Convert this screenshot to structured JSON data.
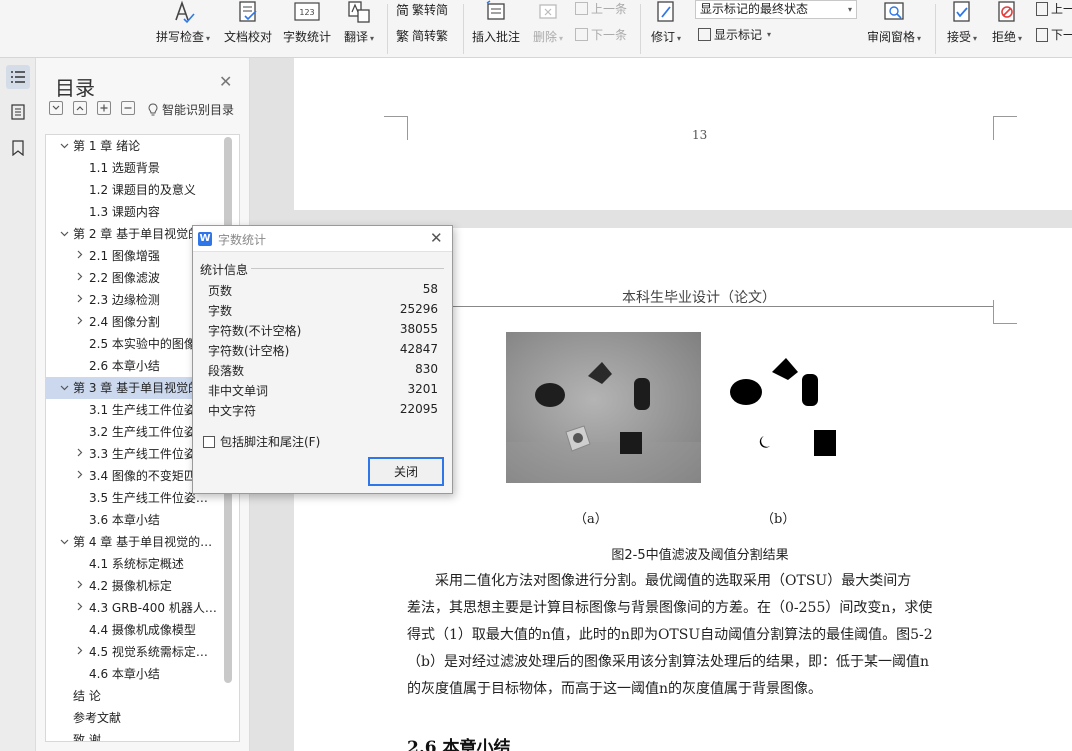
{
  "ribbon": {
    "spell_check": "拼写检查",
    "doc_proof": "文档校对",
    "word_count": "字数统计",
    "translate": "翻译",
    "trad_to_simp": "繁转简",
    "simp_to_trad": "简转繁",
    "insert_comment": "插入批注",
    "delete": "删除",
    "prev_item": "上一条",
    "next_item": "下一条",
    "revise": "修订",
    "markup_state": "显示标记的最终状态",
    "show_markup": "显示标记",
    "review_pane": "审阅窗格",
    "accept": "接受",
    "reject": "拒绝",
    "prev_change": "上一",
    "next_change": "下一",
    "icon_123": "123"
  },
  "toc": {
    "title": "目录",
    "smart_identify": "智能识别目录",
    "items": [
      {
        "label": "第 1 章  绪论",
        "level": 1,
        "chevron": "down"
      },
      {
        "label": "1.1  选题背景",
        "level": 2,
        "chevron": ""
      },
      {
        "label": "1.2  课题目的及意义",
        "level": 2,
        "chevron": ""
      },
      {
        "label": "1.3  课题内容",
        "level": 2,
        "chevron": ""
      },
      {
        "label": "第 2 章  基于单目视觉的…",
        "level": 1,
        "chevron": "down"
      },
      {
        "label": "2.1  图像增强",
        "level": 2,
        "chevron": "right"
      },
      {
        "label": "2.2  图像滤波",
        "level": 2,
        "chevron": "right"
      },
      {
        "label": "2.3  边缘检测",
        "level": 2,
        "chevron": "right"
      },
      {
        "label": "2.4  图像分割",
        "level": 2,
        "chevron": "right"
      },
      {
        "label": "2.5  本实验中的图像…",
        "level": 2,
        "chevron": ""
      },
      {
        "label": "2.6  本章小结",
        "level": 2,
        "chevron": ""
      },
      {
        "label": "第 3 章  基于单目视觉的…",
        "level": 1,
        "chevron": "down"
      },
      {
        "label": "3.1  生产线工件位姿…",
        "level": 2,
        "chevron": ""
      },
      {
        "label": "3.2  生产线工件位姿…",
        "level": 2,
        "chevron": ""
      },
      {
        "label": "3.3  生产线工件位姿…",
        "level": 2,
        "chevron": "right"
      },
      {
        "label": "3.4  图像的不变矩匹…",
        "level": 2,
        "chevron": "right"
      },
      {
        "label": "3.5  生产线工件位姿…",
        "level": 2,
        "chevron": ""
      },
      {
        "label": "3.6  本章小结",
        "level": 2,
        "chevron": ""
      },
      {
        "label": "第 4 章  基于单目视觉的…",
        "level": 1,
        "chevron": "down"
      },
      {
        "label": "4.1  系统标定概述",
        "level": 2,
        "chevron": ""
      },
      {
        "label": "4.2  摄像机标定",
        "level": 2,
        "chevron": "right"
      },
      {
        "label": "4.3 GRB-400 机器人…",
        "level": 2,
        "chevron": "right"
      },
      {
        "label": "4.4  摄像机成像模型",
        "level": 2,
        "chevron": ""
      },
      {
        "label": "4.5  视觉系统需标定…",
        "level": 2,
        "chevron": "right"
      },
      {
        "label": "4.6  本章小结",
        "level": 2,
        "chevron": ""
      },
      {
        "label": "结    论",
        "level": 1,
        "chevron": ""
      },
      {
        "label": "参考文献",
        "level": 1,
        "chevron": ""
      },
      {
        "label": "致    谢",
        "level": 1,
        "chevron": ""
      }
    ]
  },
  "document": {
    "page_number": "13",
    "running_header": "本科生毕业设计（论文）",
    "sub_a": "（a）",
    "sub_b": "（b）",
    "caption": "图2-5中值滤波及阈值分割结果",
    "para_lines": [
      "采用二值化方法对图像进行分割。最优阈值的选取采用（OTSU）最大类间方",
      "差法，其思想主要是计算目标图像与背景图像间的方差。在（0-255）间改变n，求使",
      "得式（1）取最大值的n值，此时的n即为OTSU自动阈值分割算法的最佳阈值。图5-2",
      "（b）是对经过滤波处理后的图像采用该分割算法处理后的结果，即：低于某一阈值n",
      "的灰度值属于目标物体，而高于这一阈值n的灰度值属于背景图像。"
    ],
    "section_title": "2.6  本章小结"
  },
  "dialog": {
    "title": "字数统计",
    "group_label": "统计信息",
    "stats": [
      {
        "label": "页数",
        "value": "58"
      },
      {
        "label": "字数",
        "value": "25296"
      },
      {
        "label": "字符数(不计空格)",
        "value": "38055"
      },
      {
        "label": "字符数(计空格)",
        "value": "42847"
      },
      {
        "label": "段落数",
        "value": "830"
      },
      {
        "label": "非中文单词",
        "value": "3201"
      },
      {
        "label": "中文字符",
        "value": "22095"
      }
    ],
    "include_footnotes": "包括脚注和尾注(F)",
    "close_button": "关闭",
    "logo_letter": "W"
  },
  "colors": {
    "accent": "#2f77e8",
    "selected_row": "#cbd8ee"
  }
}
